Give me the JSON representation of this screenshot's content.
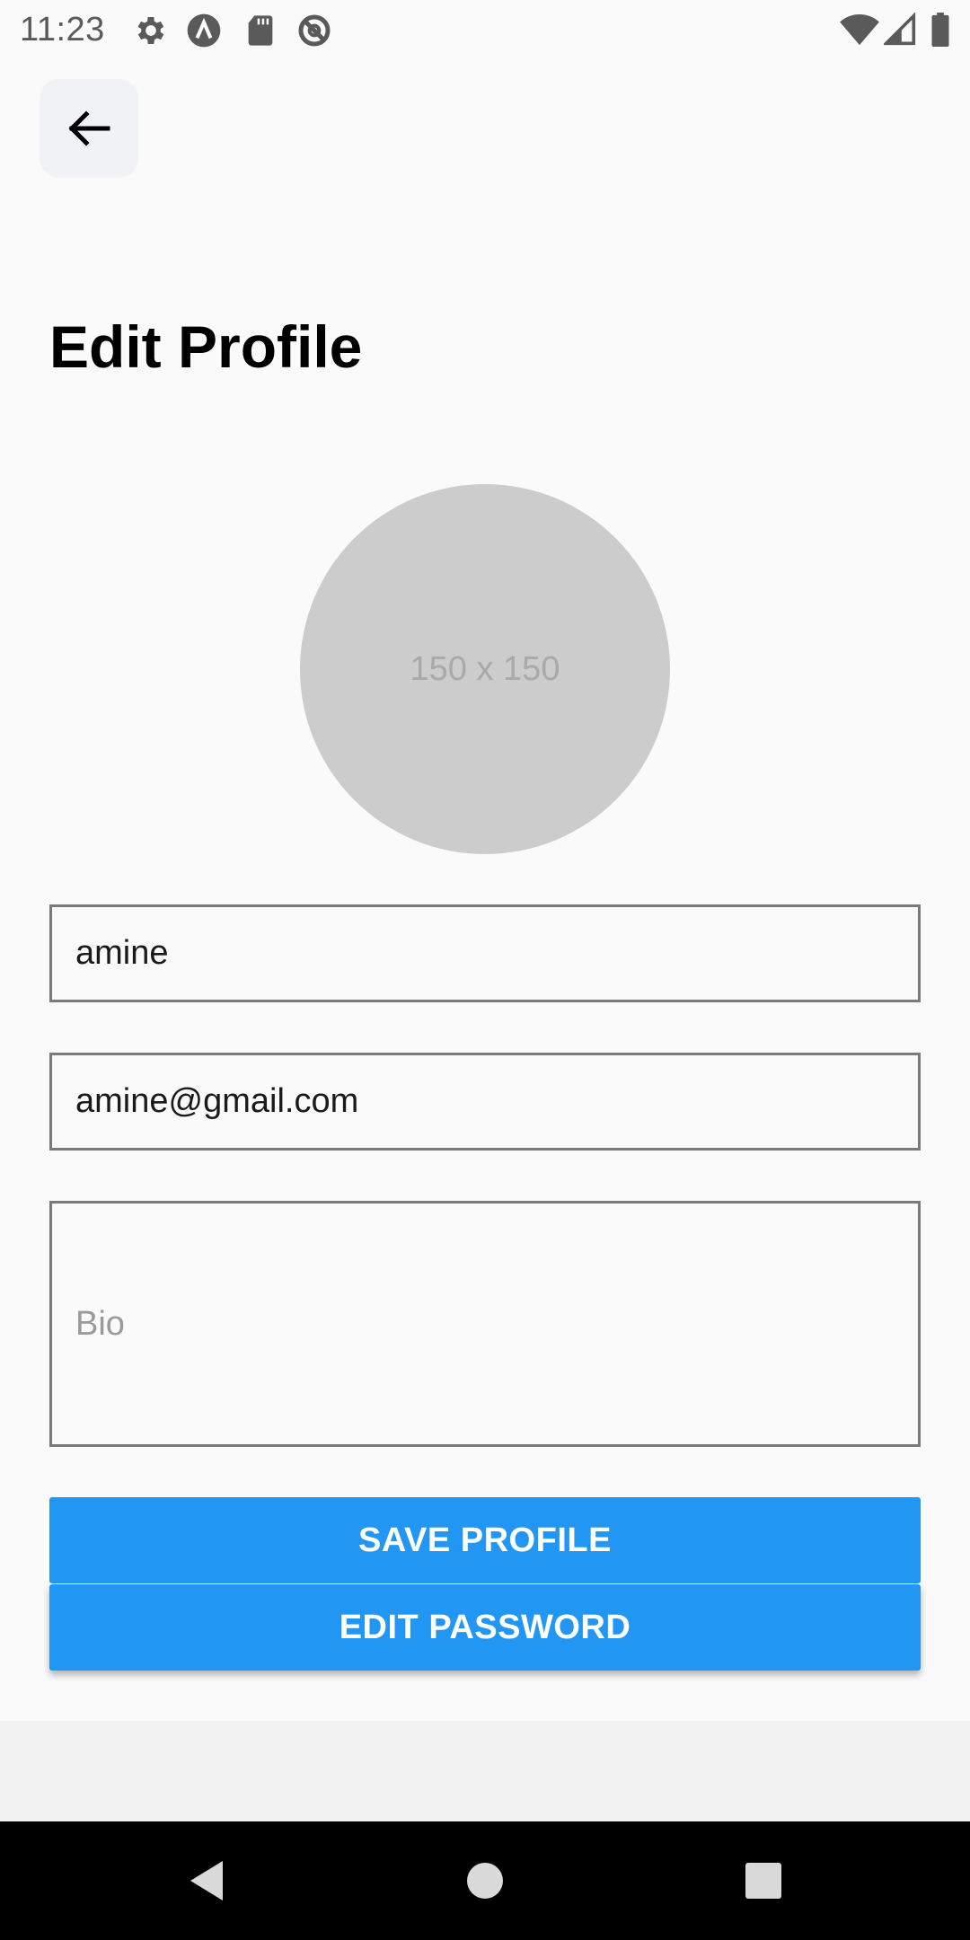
{
  "status_bar": {
    "time": "11:23",
    "left_icons": [
      "settings-icon",
      "a-circle-icon",
      "sd-card-icon",
      "no-sync-icon"
    ],
    "right_icons": [
      "wifi-icon",
      "signal-icon",
      "battery-icon"
    ]
  },
  "header": {
    "back_icon": "arrow-left-icon",
    "title": "Edit Profile"
  },
  "avatar": {
    "placeholder_text": "150 x 150"
  },
  "form": {
    "name_value": "amine",
    "email_value": "amine@gmail.com",
    "bio_placeholder": "Bio"
  },
  "buttons": {
    "save_label": "SAVE PROFILE",
    "password_label": "EDIT PASSWORD"
  },
  "nav_bar": {
    "buttons": [
      "back-triangle-icon",
      "home-circle-icon",
      "recents-square-icon"
    ]
  },
  "colors": {
    "accent": "#2196f3",
    "background": "#fafafb",
    "avatar_bg": "#cccccc"
  }
}
